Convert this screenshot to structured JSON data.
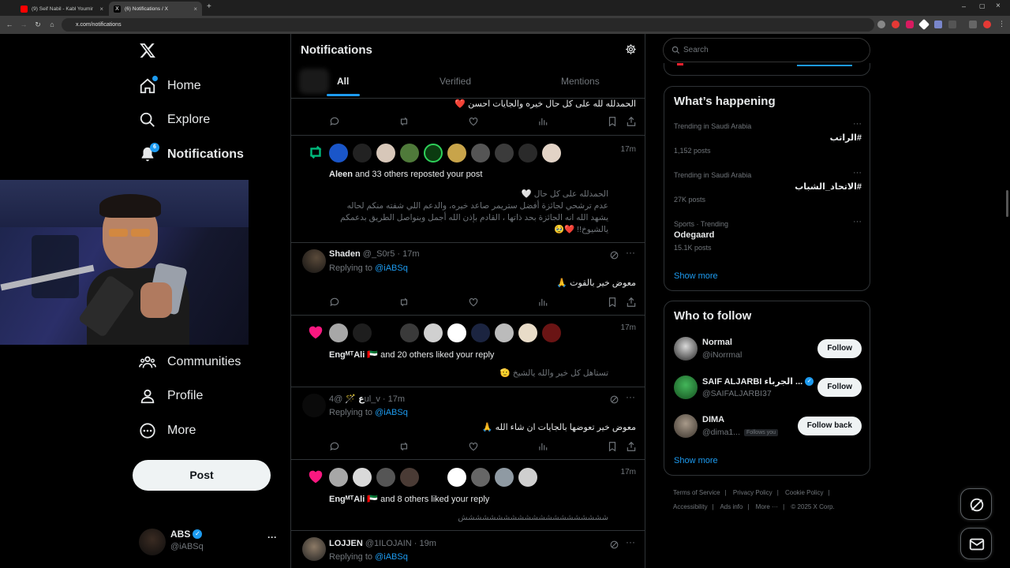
{
  "browser": {
    "tabs": [
      {
        "title": "(9) Seif Nabil - Kabl Youmin"
      },
      {
        "title": "(6) Notifications / X"
      }
    ],
    "url": "x.com/notifications"
  },
  "nav": {
    "items": [
      {
        "label": "Home",
        "icon": "home-icon"
      },
      {
        "label": "Explore",
        "icon": "search-icon"
      },
      {
        "label": "Notifications",
        "icon": "bell-icon",
        "badge": "6"
      },
      {
        "label": "Communities",
        "icon": "communities-icon"
      },
      {
        "label": "Profile",
        "icon": "person-icon"
      },
      {
        "label": "More",
        "icon": "more-circle-icon"
      }
    ],
    "post_label": "Post",
    "account": {
      "name": "ABS",
      "handle": "@iABSq",
      "more": "···"
    }
  },
  "main": {
    "title": "Notifications",
    "tabs": [
      "All",
      "Verified",
      "Mentions"
    ],
    "feed": [
      {
        "text": "الحمدلله لله على كل حال خيره والجايات احسن ❤️"
      },
      {
        "time": "17m",
        "actor": "Aleen",
        "summary": " and 33 others reposted your post",
        "text_lines": [
          "الحمدلله على كل حال 🤍",
          "عدم ترشحي لجائزة أفضل ستريمر صاعد خيره، والدعم اللي شفته منكم لحاله",
          "يشهد الله انه الجائزة بحد ذاتها ، القادم بإذن الله أجمل وبنواصل الطريق بدعمكم",
          "يالشيوخ!! ❤️🥹"
        ]
      },
      {
        "name": "Shaden",
        "handle": "@_S0r5",
        "time": "17m",
        "replying": "Replying to",
        "reply_handle": "@iABSq",
        "text": "معوض خير بالقوت 🙏"
      },
      {
        "time": "17m",
        "actor": "EngᴹᵀAli 🇦🇪",
        "summary": " and 20 others liked your reply",
        "text": "تستاهل كل خير والله يالشيخ 🫡"
      },
      {
        "name": "ع 🪄",
        "handle": "@4ul_v",
        "time": "17m",
        "replying": "Replying to",
        "reply_handle": "@iABSq",
        "text": "معوض خير تعوضها بالجايات ان شاء الله 🙏"
      },
      {
        "time": "17m",
        "actor": "EngᴹᵀAli 🇦🇪",
        "summary": " and 8 others liked your reply",
        "text": "ششششششششششششششششششششش"
      },
      {
        "name": "LOJJEN",
        "handle": "@1ILOJAIN",
        "time": "19m",
        "replying": "Replying to",
        "reply_handle": "@iABSq"
      }
    ]
  },
  "sidebar": {
    "search_placeholder": "Search",
    "happening_title": "What’s happening",
    "trends": [
      {
        "context": "Trending in Saudi Arabia",
        "name": "#الراتب",
        "posts": "1,152 posts"
      },
      {
        "context": "Trending in Saudi Arabia",
        "name": "#الاتحاد_الشباب",
        "posts": "27K posts"
      },
      {
        "context": "Sports · Trending",
        "name": "Odegaard",
        "posts": "15.1K posts"
      }
    ],
    "show_more": "Show more",
    "follow_title": "Who to follow",
    "follow": [
      {
        "name": "Normal",
        "handle": "@iNorrmal",
        "button": "Follow"
      },
      {
        "name": "SAIF ALJARBI الجرباء ...",
        "handle": "@SAIFALJARBI37",
        "button": "Follow"
      },
      {
        "name": "DIMA",
        "handle": "@dima1...",
        "tag": "Follows you",
        "button": "Follow back"
      }
    ],
    "footer": [
      "Terms of Service",
      "Privacy Policy",
      "Cookie Policy",
      "Accessibility",
      "Ads info",
      "More ···",
      "© 2025 X Corp."
    ]
  },
  "colors": {
    "accent": "#1d9bf0",
    "like": "#f91880",
    "repost": "#00ba7c"
  }
}
